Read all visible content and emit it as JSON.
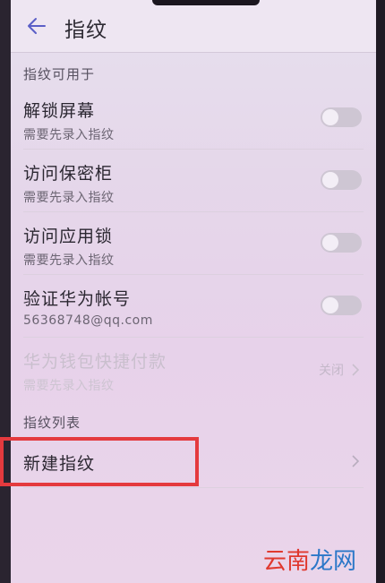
{
  "header": {
    "title": "指纹",
    "back_icon": "back-arrow-icon"
  },
  "sections": {
    "usage_header": "指纹可用于",
    "list_header": "指纹列表"
  },
  "settings": [
    {
      "title": "解锁屏幕",
      "subtitle": "需要先录入指纹",
      "enabled": false
    },
    {
      "title": "访问保密柜",
      "subtitle": "需要先录入指纹",
      "enabled": false
    },
    {
      "title": "访问应用锁",
      "subtitle": "需要先录入指纹",
      "enabled": false
    },
    {
      "title": "验证华为帐号",
      "subtitle": "56368748@qq.com",
      "enabled": false
    }
  ],
  "wallet": {
    "title": "华为钱包快捷付款",
    "subtitle": "需要先录入指纹",
    "status": "关闭"
  },
  "new_fingerprint": {
    "label": "新建指纹"
  },
  "watermark": {
    "part1": "云南",
    "part2": "龙网"
  },
  "colors": {
    "accent": "#5b5fc7",
    "highlight": "#e43a3e"
  }
}
